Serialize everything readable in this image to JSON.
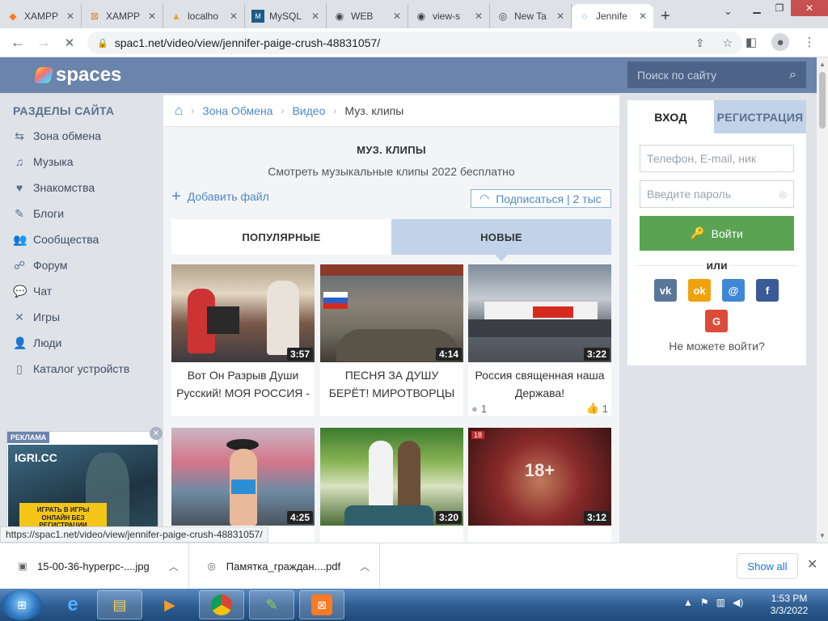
{
  "browser": {
    "tabs": [
      {
        "label": "XAMPP",
        "icon": "xampp-icon"
      },
      {
        "label": "XAMPP",
        "icon": "xampp-icon"
      },
      {
        "label": "localho",
        "icon": "pma-icon"
      },
      {
        "label": "MySQL",
        "icon": "mysql-icon"
      },
      {
        "label": "WEB",
        "icon": "eye-icon"
      },
      {
        "label": "view-s",
        "icon": "eye-icon"
      },
      {
        "label": "New Ta",
        "icon": "chrome-icon"
      },
      {
        "label": "Jennife",
        "icon": "loading-icon",
        "active": true
      }
    ],
    "url": "spac1.net/video/view/jennifer-paige-crush-48831057/",
    "status_url": "https://spac1.net/video/view/jennifer-paige-crush-48831057/"
  },
  "site": {
    "logo_text": "spaces",
    "search_placeholder": "Поиск по сайту"
  },
  "sidebar": {
    "title": "РАЗДЕЛЫ САЙТА",
    "items": [
      {
        "label": "Зона обмена",
        "icon": "exchange-icon"
      },
      {
        "label": "Музыка",
        "icon": "music-icon"
      },
      {
        "label": "Знакомства",
        "icon": "heart-icon"
      },
      {
        "label": "Блоги",
        "icon": "pen-icon"
      },
      {
        "label": "Сообщества",
        "icon": "users-icon"
      },
      {
        "label": "Форум",
        "icon": "forum-icon"
      },
      {
        "label": "Чат",
        "icon": "chat-icon"
      },
      {
        "label": "Игры",
        "icon": "games-icon"
      },
      {
        "label": "Люди",
        "icon": "people-icon"
      },
      {
        "label": "Каталог устройств",
        "icon": "device-icon"
      }
    ],
    "ad": {
      "tag": "РЕКЛАМА",
      "brand": "IGRI.CC",
      "cta": "ИГРАТЬ В ИГРЫ ОНЛАЙН БЕЗ РЕГИСТРАЦИИ"
    }
  },
  "breadcrumb": {
    "items": [
      "Зона Обмена",
      "Видео"
    ],
    "current": "Муз. клипы"
  },
  "section": {
    "title": "МУЗ. КЛИПЫ",
    "subtitle": "Смотреть музыкальные клипы 2022 бесплатно",
    "add_file": "Добавить файл",
    "subscribe": "Подписаться | 2 тыс",
    "tabs": [
      "ПОПУЛЯРНЫЕ",
      "НОВЫЕ"
    ],
    "active_tab": "НОВЫЕ"
  },
  "videos": [
    {
      "duration": "3:57",
      "title": "Вот Он Разрыв Души Русский! МОЯ РОССИЯ -",
      "comments": "",
      "likes": ""
    },
    {
      "duration": "4:14",
      "title": "ПЕСНЯ ЗА ДУШУ БЕРЁТ! МИРОТВОРЦЫ РОССИИ",
      "comments": "",
      "likes": ""
    },
    {
      "duration": "3:22",
      "title": "Россия священная наша Держава!",
      "comments": "1",
      "likes": "1"
    },
    {
      "duration": "4:25",
      "title": "",
      "comments": "",
      "likes": ""
    },
    {
      "duration": "3:20",
      "title": "",
      "comments": "",
      "likes": ""
    },
    {
      "duration": "3:12",
      "title": "",
      "comments": "",
      "likes": "",
      "age_badge": "18",
      "age_overlay": "18+"
    }
  ],
  "login": {
    "tab_login": "ВХОД",
    "tab_register": "РЕГИСТРАЦИЯ",
    "login_placeholder": "Телефон, E-mail, ник",
    "password_placeholder": "Введите пароль",
    "submit": "Войти",
    "or": "или",
    "cant_login": "Не можете войти?",
    "socials": [
      {
        "name": "vk",
        "glyph": "vk",
        "color": "#5a7699"
      },
      {
        "name": "odnoklassniki",
        "glyph": "ok",
        "color": "#f0a20c"
      },
      {
        "name": "mail",
        "glyph": "@",
        "color": "#3f88d6"
      },
      {
        "name": "facebook",
        "glyph": "f",
        "color": "#3b5a9a"
      },
      {
        "name": "google",
        "glyph": "G",
        "color": "#dd4b39"
      }
    ]
  },
  "downloads": {
    "items": [
      {
        "name": "15-00-36-hyperpc-....jpg",
        "icon": "image-file-icon"
      },
      {
        "name": "Памятка_граждан....pdf",
        "icon": "chrome-pdf-icon"
      }
    ],
    "show_all": "Show all"
  },
  "taskbar": {
    "time": "1:53 PM",
    "date": "3/3/2022"
  }
}
